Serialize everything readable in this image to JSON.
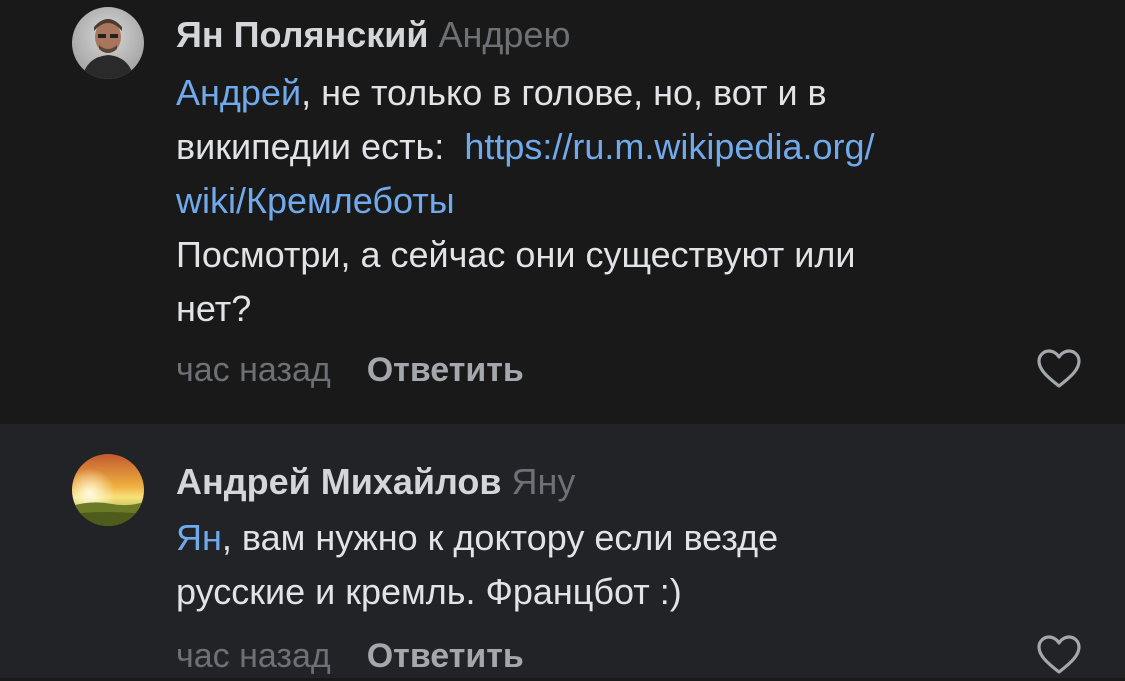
{
  "comments": [
    {
      "author": "Ян Полянский",
      "reply_to": "Андрею",
      "mention": "Андрей",
      "text_line1_rest": ", не только в голове, но, вот и в",
      "text_line2_plain": "википедии есть:  ",
      "link_part1": "https://ru.m.wikipedia.org/",
      "link_part2": "wiki/Кремлеботы",
      "text_line4": "Посмотри, а сейчас они существуют или",
      "text_line5": "нет?",
      "time": "час назад",
      "reply_label": "Ответить",
      "like_icon": "heart-outline-icon"
    },
    {
      "author": "Андрей Михайлов",
      "reply_to": "Яну",
      "mention": "Ян",
      "text_line1_rest": ", вам нужно к доктору если везде",
      "text_line2": "русские и кремль. Францбот :)",
      "time": "час назад",
      "reply_label": "Ответить",
      "like_icon": "heart-outline-icon"
    }
  ],
  "colors": {
    "background_1": "#19191a",
    "background_2": "#222327",
    "link": "#71aaeb",
    "secondary_text": "#6d7075",
    "primary_text": "#e1e3e6"
  }
}
